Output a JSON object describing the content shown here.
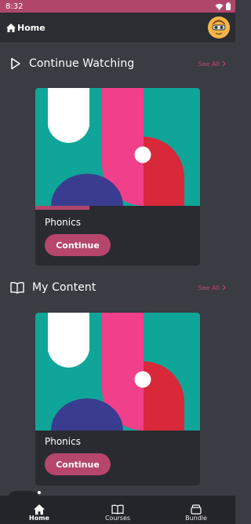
{
  "status_bar": {
    "time": "8:32",
    "icons": [
      "signal-icon",
      "wifi-icon",
      "battery-icon"
    ]
  },
  "app_bar": {
    "title": "Home"
  },
  "sections": [
    {
      "title": "Continue Watching",
      "see_all": "See All",
      "icon": "play-icon",
      "card": {
        "title": "Phonics",
        "button": "Continue",
        "progress": 0.33
      }
    },
    {
      "title": "My Content",
      "see_all": "See All",
      "icon": "book-icon",
      "card": {
        "title": "Phonics",
        "button": "Continue"
      }
    }
  ],
  "bottom_nav": [
    {
      "label": "Home",
      "icon": "home-icon",
      "active": true
    },
    {
      "label": "Courses",
      "icon": "book-icon",
      "active": false
    },
    {
      "label": "Bundle",
      "icon": "bundle-icon",
      "active": false
    }
  ],
  "colors": {
    "accent": "#b6466b",
    "background": "#3a3b43",
    "card": "#2a2b31",
    "art_teal": "#10a599",
    "art_pink": "#f0408a",
    "art_red": "#d8283a",
    "art_navy": "#3a3d8f"
  }
}
